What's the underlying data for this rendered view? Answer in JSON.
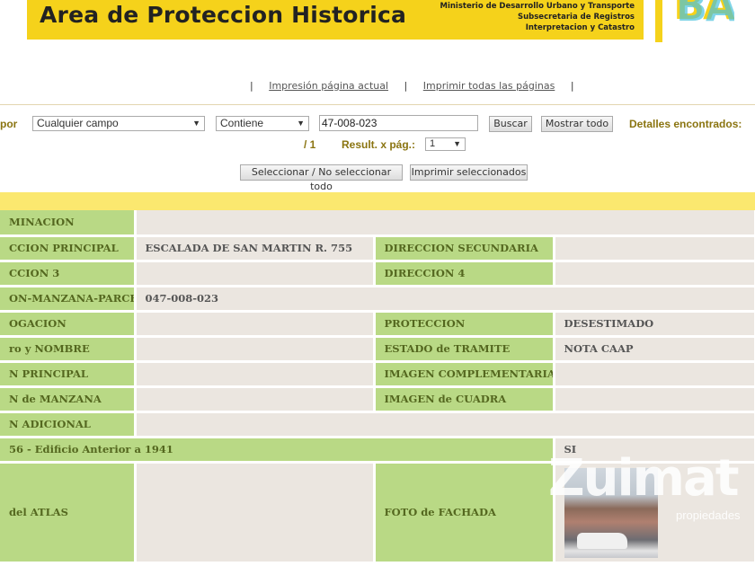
{
  "header": {
    "title": "Area de Proteccion Historica",
    "ministry_lines": [
      "Ministerio de Desarrollo Urbano y Transporte",
      "Subsecretaria de Registros",
      "Interpretacion y Catastro"
    ],
    "logo_text": "BA"
  },
  "print": {
    "current_page": "Impresión página actual",
    "all_pages": "Imprimir todas las páginas",
    "separator": "|"
  },
  "filter": {
    "label": "por",
    "field_select": "Cualquier campo",
    "op_select": "Contiene",
    "query": "47-008-023",
    "search_button": "Buscar",
    "show_all_button": "Mostrar todo",
    "found_label": "Detalles encontrados:",
    "pager": "/ 1",
    "per_page_label": "Result. x pág.:",
    "per_page_value": "1"
  },
  "actions": {
    "toggle_select": "Seleccionar / No seleccionar todo",
    "print_selected": "Imprimir seleccionados"
  },
  "rows": [
    {
      "l1": "MINACION",
      "v1": "",
      "l2": "",
      "v2": ""
    },
    {
      "l1": "CCION PRINCIPAL",
      "v1": "ESCALADA DE SAN MARTIN R. 755",
      "l2": "DIRECCION SECUNDARIA",
      "v2": ""
    },
    {
      "l1": "CCION 3",
      "v1": "",
      "l2": "DIRECCION 4",
      "v2": ""
    },
    {
      "l1": "ON-MANZANA-PARCELA",
      "v1": "047-008-023",
      "l2": "",
      "v2": ""
    },
    {
      "l1": "OGACION",
      "v1": "",
      "l2": "PROTECCION",
      "v2": "DESESTIMADO"
    },
    {
      "l1": "ro y NOMBRE",
      "v1": "",
      "l2": "ESTADO de TRAMITE",
      "v2": "NOTA CAAP"
    },
    {
      "l1": "N PRINCIPAL",
      "v1": "",
      "l2": "IMAGEN COMPLEMENTARIA",
      "v2": ""
    },
    {
      "l1": "N de MANZANA",
      "v1": "",
      "l2": "IMAGEN de CUADRA",
      "v2": ""
    },
    {
      "l1": "N ADICIONAL",
      "v1": "",
      "l2": "",
      "v2": ""
    },
    {
      "l1": "56 - Edificio Anterior a 1941",
      "v1": "SI",
      "l2": "",
      "v2": ""
    },
    {
      "l1": "del ATLAS",
      "v1": "",
      "l2": "FOTO de FACHADA",
      "v2": ""
    }
  ],
  "watermark": {
    "brand": "Zuimat",
    "sub": "propiedades"
  }
}
